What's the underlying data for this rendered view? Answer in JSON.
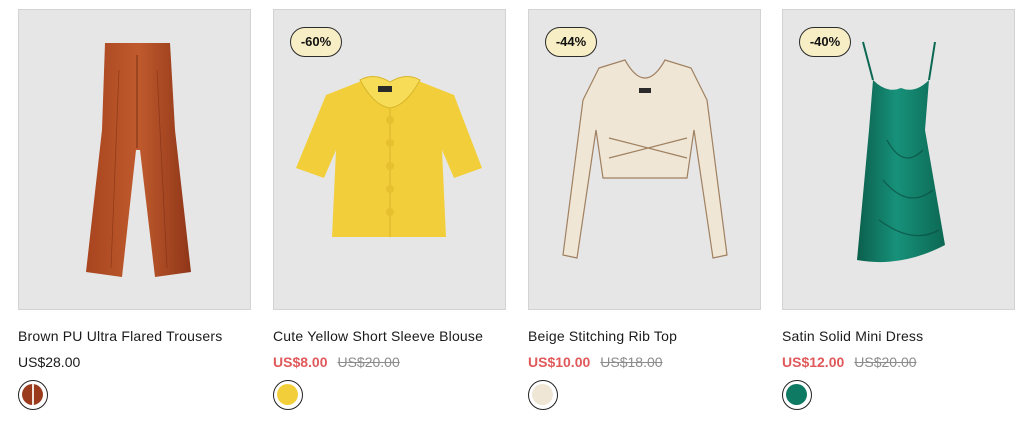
{
  "colors": {
    "sale_price": "#e0595b",
    "badge_bg": "#f8eec5",
    "card_bg": "#e6e6e6"
  },
  "products": [
    {
      "name": "Brown PU Ultra Flared Trousers",
      "price": "US$28.00",
      "original_price": "",
      "discount_badge": "",
      "image_icon": "brown-trousers",
      "swatch_color": "#9b3b1e"
    },
    {
      "name": "Cute Yellow Short Sleeve Blouse",
      "price": "US$8.00",
      "original_price": "US$20.00",
      "discount_badge": "-60%",
      "image_icon": "yellow-blouse",
      "swatch_color": "#f2cf3a"
    },
    {
      "name": "Beige Stitching Rib Top",
      "price": "US$10.00",
      "original_price": "US$18.00",
      "discount_badge": "-44%",
      "image_icon": "beige-top",
      "swatch_color": "#efe6d6"
    },
    {
      "name": "Satin Solid Mini Dress",
      "price": "US$12.00",
      "original_price": "US$20.00",
      "discount_badge": "-40%",
      "image_icon": "green-dress",
      "swatch_color": "#0f7a63"
    }
  ]
}
